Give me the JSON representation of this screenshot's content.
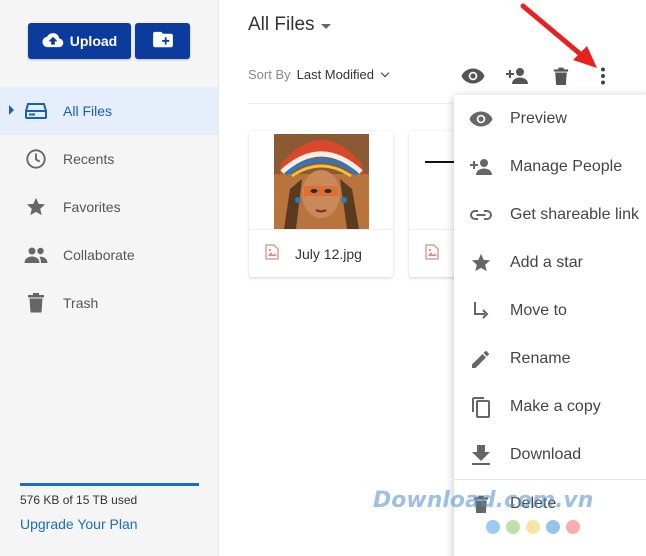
{
  "sidebar": {
    "upload_label": "Upload",
    "items": [
      {
        "label": "All Files",
        "icon": "drive-icon",
        "active": true
      },
      {
        "label": "Recents",
        "icon": "clock-icon"
      },
      {
        "label": "Favorites",
        "icon": "star-icon"
      },
      {
        "label": "Collaborate",
        "icon": "people-icon"
      },
      {
        "label": "Trash",
        "icon": "trash-icon"
      }
    ],
    "usage_text": "576 KB of 15 TB used",
    "upgrade_label": "Upgrade Your Plan"
  },
  "header": {
    "title": "All Files",
    "sort_label": "Sort By",
    "sort_value": "Last Modified"
  },
  "files": [
    {
      "name": "July 12.jpg",
      "icon": "image-file-icon"
    },
    {
      "name": "",
      "icon": "image-file-icon"
    }
  ],
  "menu": {
    "items": [
      {
        "label": "Preview",
        "icon": "eye-icon"
      },
      {
        "label": "Manage People",
        "icon": "add-person-icon"
      },
      {
        "label": "Get shareable link",
        "icon": "link-icon"
      },
      {
        "label": "Add a star",
        "icon": "star-icon"
      },
      {
        "label": "Move to",
        "icon": "move-arrow-icon"
      },
      {
        "label": "Rename",
        "icon": "pencil-icon"
      },
      {
        "label": "Make a copy",
        "icon": "copy-icon"
      },
      {
        "label": "Download",
        "icon": "download-icon"
      },
      {
        "label": "Delete",
        "icon": "trash-icon"
      }
    ]
  },
  "watermark": {
    "text": "Download.com.vn",
    "dot_colors": [
      "#5aa7e6",
      "#8fd06d",
      "#f3d36b",
      "#4e9ee0",
      "#f07a7a"
    ]
  },
  "colors": {
    "accent": "#0b3b9c",
    "active_bg": "#e6eefb",
    "link": "#1a6cc4",
    "annotation_arrow": "#e8201e"
  }
}
